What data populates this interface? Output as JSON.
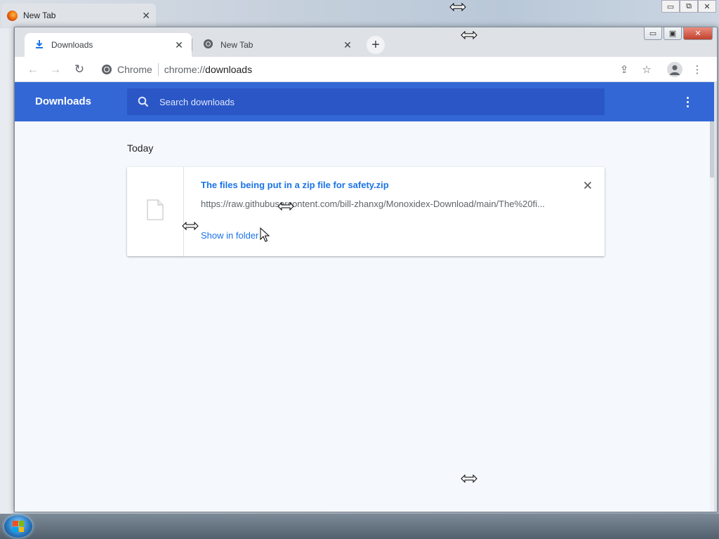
{
  "background_window": {
    "tab_title": "New Tab",
    "tab_close": "✕",
    "caption": {
      "minimize": "▭",
      "restore": "⧉",
      "close": "✕"
    }
  },
  "window": {
    "tabs": [
      {
        "label": "Downloads",
        "icon": "download-icon",
        "close": "✕",
        "active": true
      },
      {
        "label": "New Tab",
        "icon": "chrome-icon",
        "close": "✕",
        "active": false
      }
    ],
    "new_tab_label": "+",
    "caption": {
      "minimize": "▭",
      "maximize": "▣",
      "close": "✕"
    }
  },
  "toolbar": {
    "back_icon": "←",
    "forward_icon": "→",
    "reload_icon": "↻",
    "omnibox": {
      "site_label": "Chrome",
      "url_scheme": "chrome://",
      "url_host": "downloads"
    },
    "share_icon": "⇪",
    "star_icon": "☆",
    "menu_icon": "⋮"
  },
  "page": {
    "header_title": "Downloads",
    "search_placeholder": "Search downloads",
    "section_date": "Today",
    "downloads": [
      {
        "file_name": "The files being put in a zip file for safety.zip",
        "url": "https://raw.githubusercontent.com/bill-zhanxg/Monoxidex-Download/main/The%20fi...",
        "action_label": "Show in folder"
      }
    ]
  },
  "colors": {
    "header_blue": "#3367d6",
    "search_blue": "#2a56c6",
    "link_blue": "#1a73e8",
    "page_bg": "#f5f8fc"
  }
}
